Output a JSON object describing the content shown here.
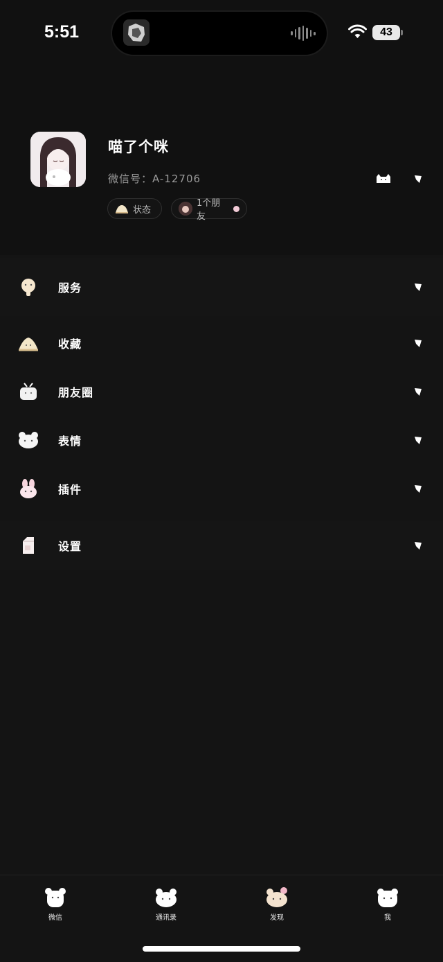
{
  "status_bar": {
    "time": "5:51",
    "battery": "43"
  },
  "profile": {
    "nickname": "喵了个咪",
    "wechat_id": "微信号：A-12706",
    "status_chip": "状态",
    "friends_chip": "1个朋友"
  },
  "menu": {
    "services": "服务",
    "favorites": "收藏",
    "moments": "朋友圈",
    "stickers": "表情",
    "plugins": "插件",
    "settings": "设置"
  },
  "tabbar": {
    "chats": "微信",
    "contacts": "通讯录",
    "discover": "发现",
    "me": "我"
  },
  "icons": {
    "services": "bear-service-icon",
    "favorites": "folder-bear-icon",
    "moments": "tv-bear-icon",
    "stickers": "bear-face-icon",
    "plugins": "bunny-icon",
    "settings": "milk-box-icon"
  },
  "colors": {
    "background": "#141414",
    "accent_pink": "#f2cbd7"
  }
}
